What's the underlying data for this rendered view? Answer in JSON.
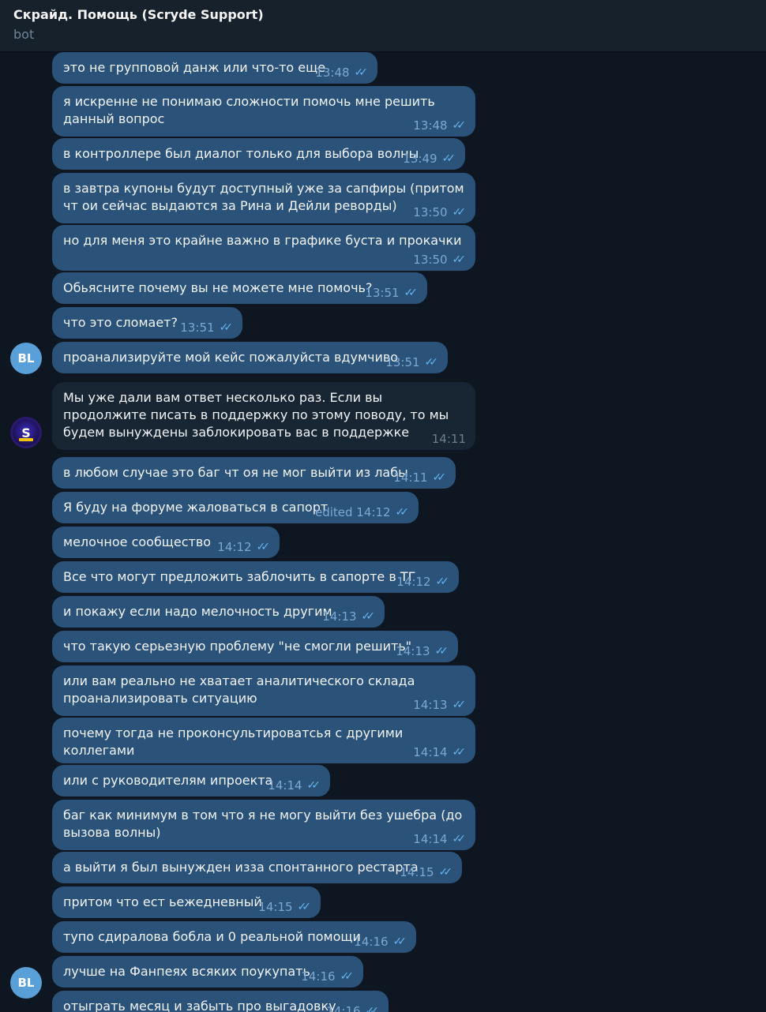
{
  "header": {
    "title": "Скрайд. Помощь (Scryde Support)",
    "subtitle": "bot"
  },
  "avatars": {
    "user_initials": "BL",
    "bot_logo_letter": "S"
  },
  "messages": [
    {
      "text": "это не групповой данж или что-то еще",
      "time": "13:48"
    },
    {
      "text": "я искренне не понимаю сложности помочь мне решить данный вопрос",
      "time": "13:48"
    },
    {
      "text": "в контроллере был диалог только для выбора волны",
      "time": "13:49"
    },
    {
      "text": "в завтра купоны будут доступный уже за сапфиры (притом чт ои сейчас выдаются за Рина и Дейли реворды)",
      "time": "13:50"
    },
    {
      "text": "но для меня это крайне важно в графике буста и прокачки",
      "time": "13:50"
    },
    {
      "text": "Обьясните почему вы не можете мне помочь?",
      "time": "13:51"
    },
    {
      "text": "что это сломает?",
      "time": "13:51"
    },
    {
      "text": "проанализируйте мой кейс пожалуйста вдумчиво",
      "time": "13:51"
    },
    {
      "text": "Мы уже дали вам ответ несколько раз. Если вы продолжите писать в поддержку по этому поводу, то мы будем вынуждены заблокировать вас в поддержке",
      "time": "14:11"
    },
    {
      "text": "в любом случае это баг чт оя не мог выйти из лабы",
      "time": "14:11"
    },
    {
      "text": "Я буду на форуме жаловаться в сапорт",
      "time": "edited 14:12"
    },
    {
      "text": "мелочное сообщество",
      "time": "14:12"
    },
    {
      "text": "Все что могут предложить заблочить в сапорте в ТГ",
      "time": "14:12"
    },
    {
      "text": "и покажу если надо мелочность другим",
      "time": "14:13"
    },
    {
      "text": "что такую серьезную проблему \"не смогли решить\"",
      "time": "14:13"
    },
    {
      "text": "или вам реально не хватает аналитического склада проанализировать ситуацию",
      "time": "14:13"
    },
    {
      "text": "почему тогда не проконсультироватсья с другими коллегами",
      "time": "14:14"
    },
    {
      "text": "или с руководителям ипроекта",
      "time": "14:14"
    },
    {
      "text": "баг как минимум в том что я не могу выйти без ушебра (до вызова волны)",
      "time": "14:14"
    },
    {
      "text": "а выйти я был вынужден изза спонтанного рестарта",
      "time": "14:15"
    },
    {
      "text": "притом что ест ьежедневный",
      "time": "14:15"
    },
    {
      "text": "тупо сдиралова бобла и 0 реальной помощи",
      "time": "14:16"
    },
    {
      "text": "лучше на Фанпеях всяких поукупать",
      "time": "14:16"
    },
    {
      "text": "отыграть месяц и забыть про выгадовку",
      "time": "14:16"
    }
  ],
  "colors": {
    "background": "#0e1621",
    "header": "#17212b",
    "outgoing_bubble": "#2b5278",
    "incoming_bubble": "#182533",
    "read_check": "#64b5ef"
  }
}
